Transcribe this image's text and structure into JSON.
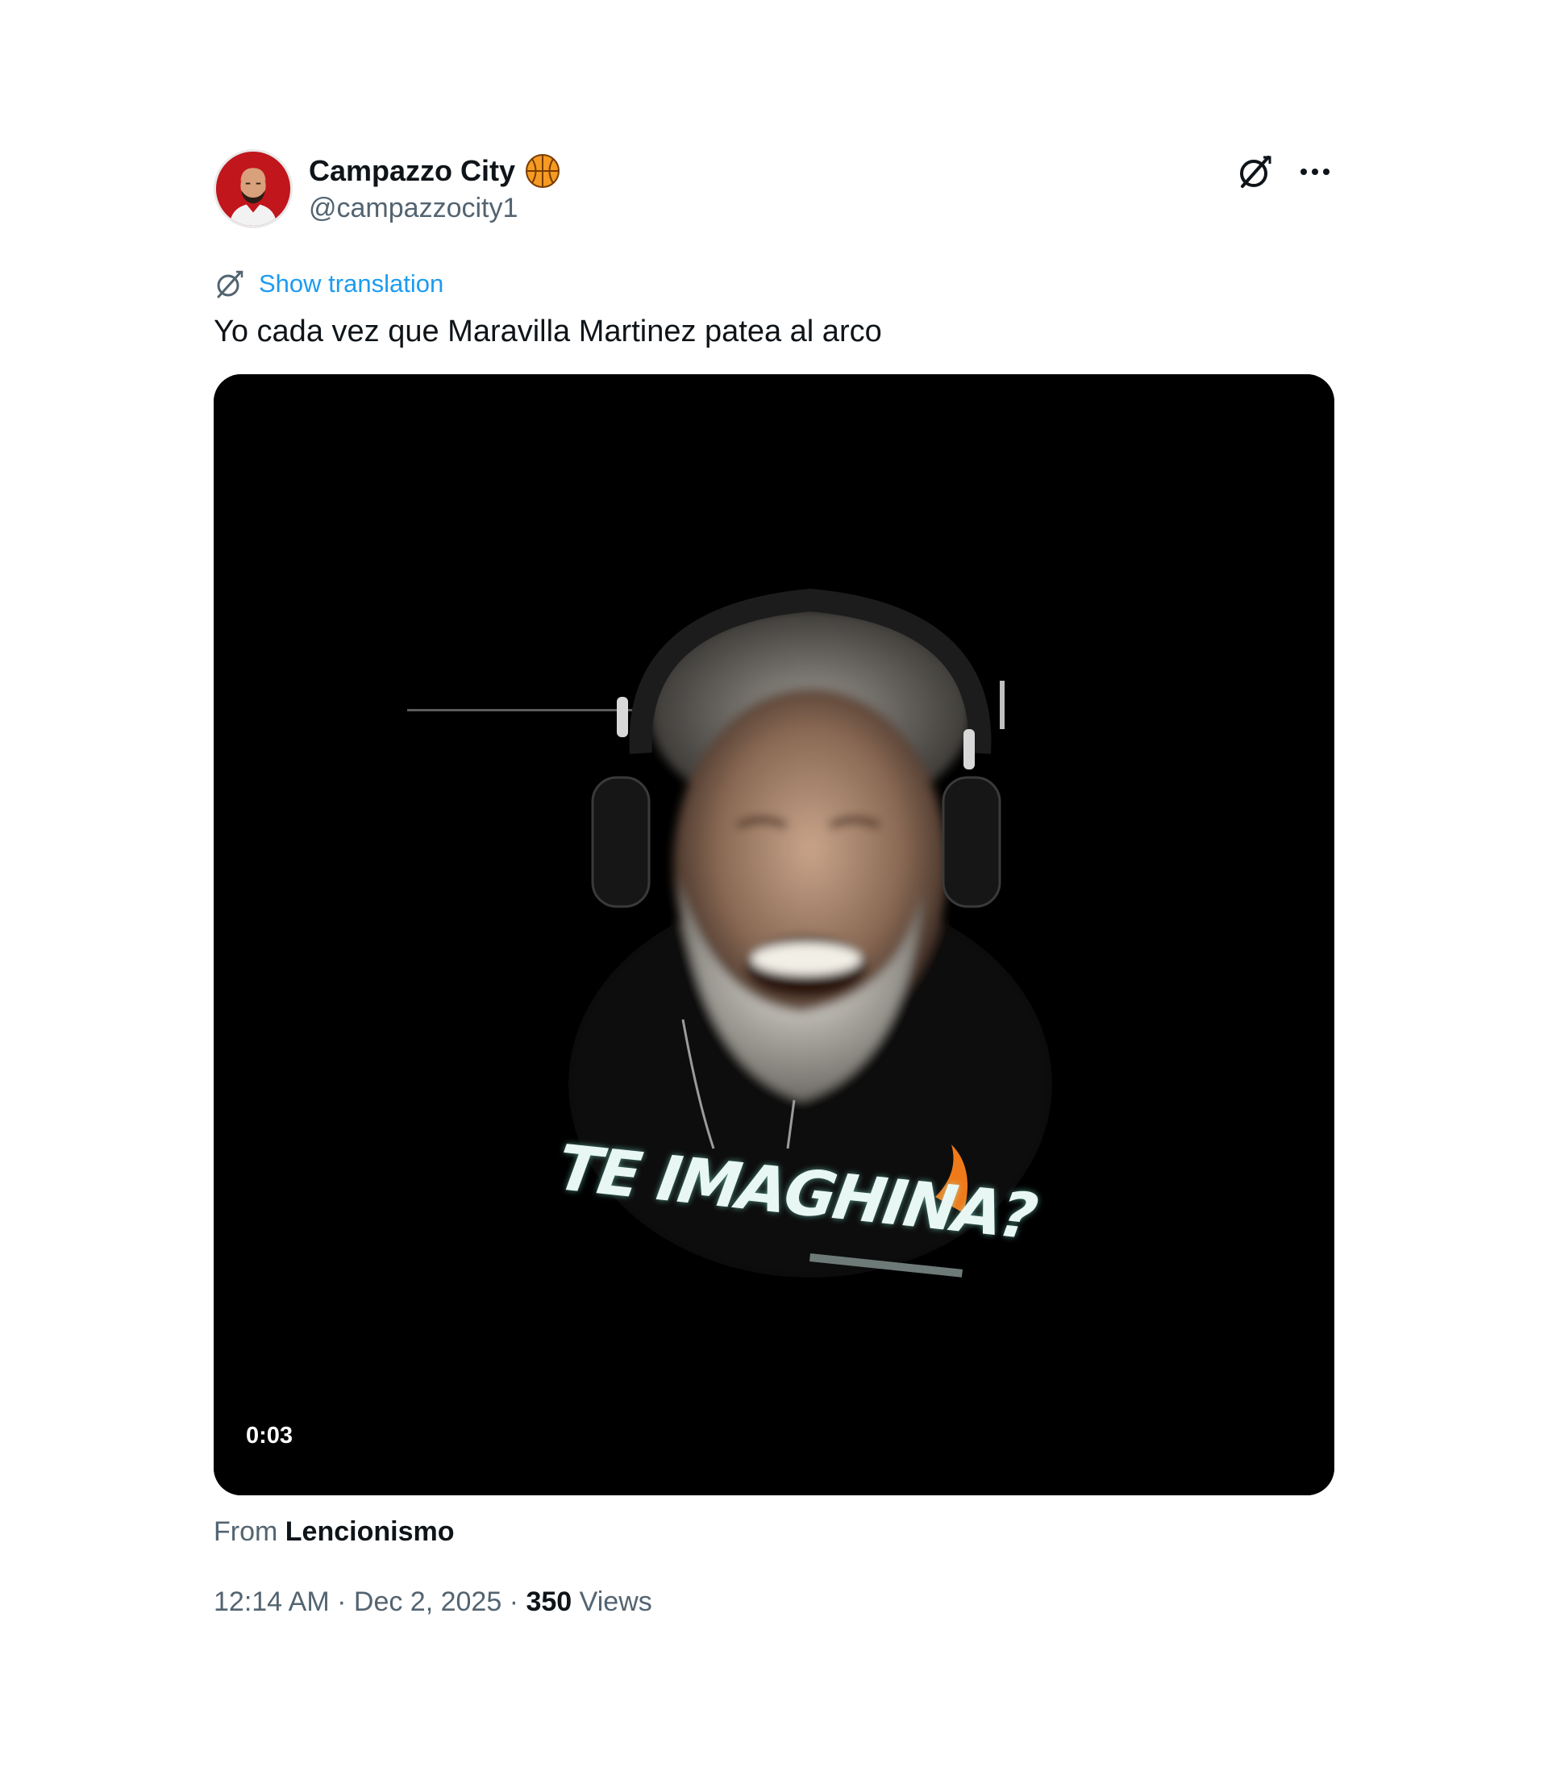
{
  "author": {
    "display_name": "Campazzo City",
    "handle": "@campazzocity1",
    "badge_icon": "basketball-icon",
    "avatar_bg": "#c0161c"
  },
  "actions": {
    "grok_icon": "grok-icon",
    "more_icon": "more-icon"
  },
  "translation": {
    "label": "Show translation",
    "color": "#1d9bf0"
  },
  "tweet": {
    "text": "Yo cada vez que Maravilla Martinez patea al arco"
  },
  "media": {
    "duration": "0:03",
    "shirt_text": "TE IMAGHINA?"
  },
  "source": {
    "prefix": "From",
    "name": "Lencionismo"
  },
  "meta": {
    "time": "12:14 AM",
    "separator": "·",
    "date": "Dec 2, 2025",
    "views_count": "350",
    "views_label": "Views"
  }
}
